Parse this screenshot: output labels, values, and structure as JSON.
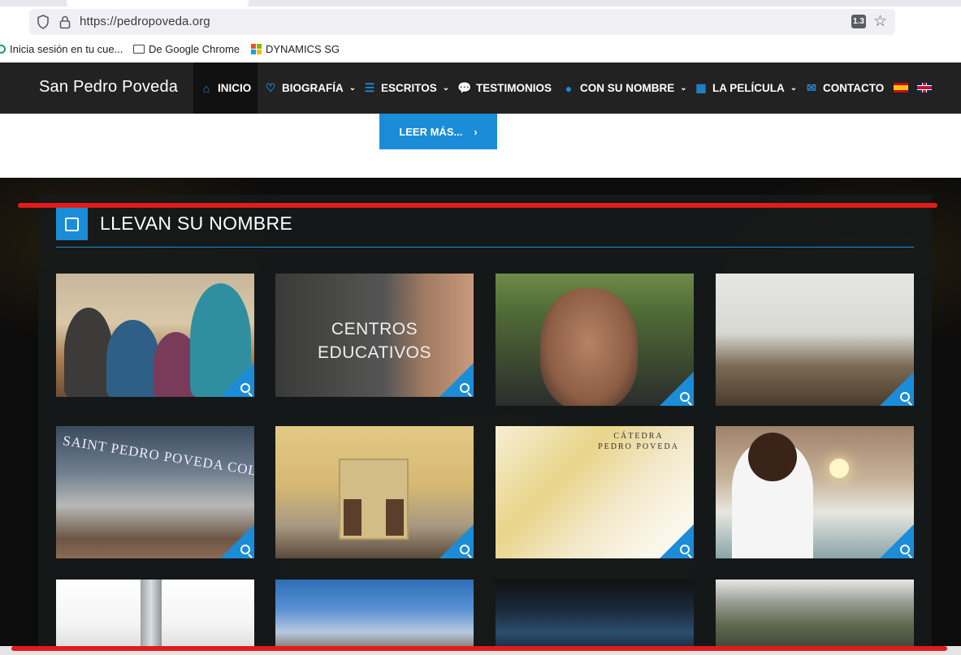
{
  "browser": {
    "url": "https://pedropoveda.org",
    "zoom": "1.3",
    "bookmarks": [
      {
        "label": "Inicia sesión en tu cue..."
      },
      {
        "label": "De Google Chrome"
      },
      {
        "label": "DYNAMICS SG"
      }
    ]
  },
  "site": {
    "brand": "San Pedro Poveda",
    "nav": [
      {
        "label": "INICIO",
        "icon": "home-icon"
      },
      {
        "label": "BIOGRAFÍA",
        "icon": "heart-icon"
      },
      {
        "label": "ESCRITOS",
        "icon": "list-icon"
      },
      {
        "label": "TESTIMONIOS",
        "icon": "comment-icon"
      },
      {
        "label": "CON SU NOMBRE",
        "icon": "globe-icon"
      },
      {
        "label": "LA PELÍCULA",
        "icon": "film-icon"
      },
      {
        "label": "CONTACTO",
        "icon": "envelope-icon"
      }
    ],
    "leer_mas": "LEER MÁS...",
    "section_title": "LLEVAN SU NOMBRE",
    "tile_texts": {
      "centros": "CENTROS\nEDUCATIVOS",
      "catedra_1": "CÁTEDRA",
      "catedra_2": "PEDRO POVEDA",
      "college": "SAINT PEDRO POVEDA COLLEGE"
    }
  },
  "colors": {
    "accent": "#1b8dd8",
    "nav_bg": "#222222",
    "annotation_red": "#e21b1b"
  }
}
